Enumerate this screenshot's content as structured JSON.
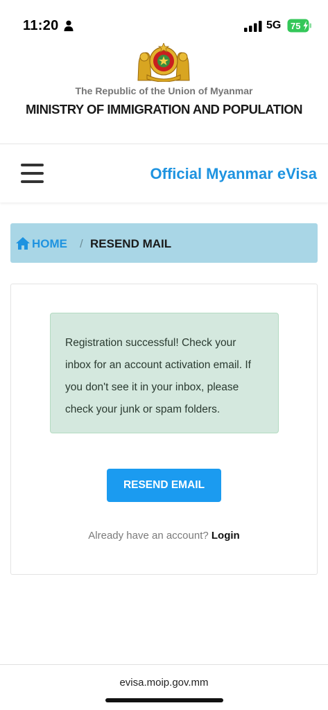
{
  "status_bar": {
    "time": "11:20",
    "network": "5G",
    "battery": "75",
    "icons": [
      "person-icon",
      "signal-icon",
      "battery-icon"
    ]
  },
  "header": {
    "republic": "The Republic of the Union of Myanmar",
    "ministry": "MINISTRY OF IMMIGRATION AND POPULATION"
  },
  "navbar": {
    "brand": "Official Myanmar eVisa",
    "menu_icon": "hamburger-menu-icon"
  },
  "breadcrumb": {
    "home": "HOME",
    "separator": "/",
    "current": "RESEND MAIL",
    "home_icon": "home-icon"
  },
  "alert": {
    "message": "Registration successful! Check your inbox for an account activation email. If you don't see it in your inbox, please check your junk or spam folders."
  },
  "actions": {
    "resend_label": "RESEND EMAIL",
    "account_prompt": "Already have an account?",
    "login_label": "Login"
  },
  "browser": {
    "url": "evisa.moip.gov.mm"
  },
  "colors": {
    "brand_blue": "#1e93e0",
    "button_blue": "#1b9bf0",
    "breadcrumb_bg": "#a9d6e6",
    "alert_bg": "#d4e8de",
    "battery_green": "#34c759"
  }
}
